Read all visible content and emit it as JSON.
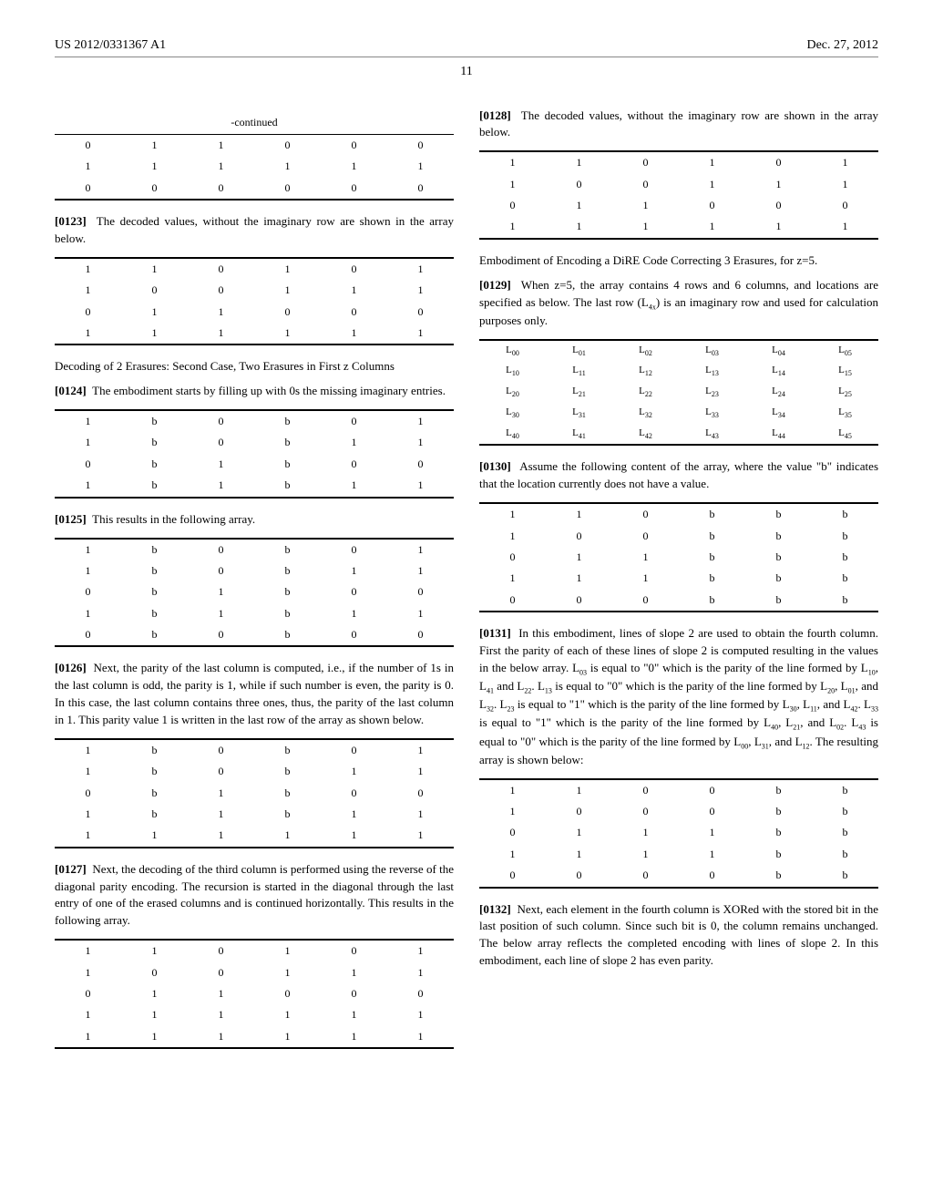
{
  "header": {
    "pub_number": "US 2012/0331367 A1",
    "pub_date": "Dec. 27, 2012"
  },
  "page_number": "11",
  "left": {
    "continued_title": "-continued",
    "t1": {
      "rows": [
        [
          "0",
          "1",
          "1",
          "0",
          "0",
          "0"
        ],
        [
          "1",
          "1",
          "1",
          "1",
          "1",
          "1"
        ],
        [
          "0",
          "0",
          "0",
          "0",
          "0",
          "0"
        ]
      ]
    },
    "p0123": {
      "num": "[0123]",
      "text": "The decoded values, without the imaginary row are shown in the array below."
    },
    "t2": {
      "rows": [
        [
          "1",
          "1",
          "0",
          "1",
          "0",
          "1"
        ],
        [
          "1",
          "0",
          "0",
          "1",
          "1",
          "1"
        ],
        [
          "0",
          "1",
          "1",
          "0",
          "0",
          "0"
        ],
        [
          "1",
          "1",
          "1",
          "1",
          "1",
          "1"
        ]
      ]
    },
    "subhead1": "Decoding of 2 Erasures: Second Case, Two Erasures in First z Columns",
    "p0124": {
      "num": "[0124]",
      "text": "The embodiment starts by filling up with 0s the missing imaginary entries."
    },
    "t3": {
      "rows": [
        [
          "1",
          "b",
          "0",
          "b",
          "0",
          "1"
        ],
        [
          "1",
          "b",
          "0",
          "b",
          "1",
          "1"
        ],
        [
          "0",
          "b",
          "1",
          "b",
          "0",
          "0"
        ],
        [
          "1",
          "b",
          "1",
          "b",
          "1",
          "1"
        ]
      ]
    },
    "p0125": {
      "num": "[0125]",
      "text": "This results in the following array."
    },
    "t4": {
      "rows": [
        [
          "1",
          "b",
          "0",
          "b",
          "0",
          "1"
        ],
        [
          "1",
          "b",
          "0",
          "b",
          "1",
          "1"
        ],
        [
          "0",
          "b",
          "1",
          "b",
          "0",
          "0"
        ],
        [
          "1",
          "b",
          "1",
          "b",
          "1",
          "1"
        ],
        [
          "0",
          "b",
          "0",
          "b",
          "0",
          "0"
        ]
      ]
    },
    "p0126": {
      "num": "[0126]",
      "text": "Next, the parity of the last column is computed, i.e., if the number of 1s in the last column is odd, the parity is 1, while if such number is even, the parity is 0. In this case, the last column contains three ones, thus, the parity of the last column in 1. This parity value 1 is written in the last row of the array as shown below."
    },
    "t5": {
      "rows": [
        [
          "1",
          "b",
          "0",
          "b",
          "0",
          "1"
        ],
        [
          "1",
          "b",
          "0",
          "b",
          "1",
          "1"
        ],
        [
          "0",
          "b",
          "1",
          "b",
          "0",
          "0"
        ],
        [
          "1",
          "b",
          "1",
          "b",
          "1",
          "1"
        ],
        [
          "1",
          "1",
          "1",
          "1",
          "1",
          "1"
        ]
      ]
    },
    "p0127": {
      "num": "[0127]",
      "text": "Next, the decoding of the third column is performed using the reverse of the diagonal parity encoding. The recursion is started in the diagonal through the last entry of one of the erased columns and is continued horizontally. This results in the following array."
    },
    "t6": {
      "rows": [
        [
          "1",
          "1",
          "0",
          "1",
          "0",
          "1"
        ],
        [
          "1",
          "0",
          "0",
          "1",
          "1",
          "1"
        ],
        [
          "0",
          "1",
          "1",
          "0",
          "0",
          "0"
        ],
        [
          "1",
          "1",
          "1",
          "1",
          "1",
          "1"
        ],
        [
          "1",
          "1",
          "1",
          "1",
          "1",
          "1"
        ]
      ]
    }
  },
  "right": {
    "p0128": {
      "num": "[0128]",
      "text": "The decoded values, without the imaginary row are shown in the array below."
    },
    "t7": {
      "rows": [
        [
          "1",
          "1",
          "0",
          "1",
          "0",
          "1"
        ],
        [
          "1",
          "0",
          "0",
          "1",
          "1",
          "1"
        ],
        [
          "0",
          "1",
          "1",
          "0",
          "0",
          "0"
        ],
        [
          "1",
          "1",
          "1",
          "1",
          "1",
          "1"
        ]
      ]
    },
    "subhead2": "Embodiment of Encoding a DiRE Code Correcting 3 Erasures, for z=5.",
    "p0129_a": "When z=5, the array contains 4 rows and 6 columns, and locations are specified as below. The last row (",
    "p0129_b": ") is an imaginary row and used for calculation purposes only.",
    "p0129_num": "[0129]",
    "t8": {
      "rows": [
        [
          "L00",
          "L01",
          "L02",
          "L03",
          "L04",
          "L05"
        ],
        [
          "L10",
          "L11",
          "L12",
          "L13",
          "L14",
          "L15"
        ],
        [
          "L20",
          "L21",
          "L22",
          "L23",
          "L24",
          "L25"
        ],
        [
          "L30",
          "L31",
          "L32",
          "L33",
          "L34",
          "L35"
        ],
        [
          "L40",
          "L41",
          "L42",
          "L43",
          "L44",
          "L45"
        ]
      ]
    },
    "p0130": {
      "num": "[0130]",
      "text": "Assume the following content of the array, where the value \"b\" indicates that the location currently does not have a value."
    },
    "t9": {
      "rows": [
        [
          "1",
          "1",
          "0",
          "b",
          "b",
          "b"
        ],
        [
          "1",
          "0",
          "0",
          "b",
          "b",
          "b"
        ],
        [
          "0",
          "1",
          "1",
          "b",
          "b",
          "b"
        ],
        [
          "1",
          "1",
          "1",
          "b",
          "b",
          "b"
        ],
        [
          "0",
          "0",
          "0",
          "b",
          "b",
          "b"
        ]
      ]
    },
    "p0131_num": "[0131]",
    "p0131_text_a": "In this embodiment, lines of slope 2 are used to obtain the fourth column. First the parity of each of these lines of slope 2 is computed resulting in the values in the below array. L",
    "p0131_text_b": " is equal to \"0\" which is the parity of the line formed by L",
    "p0131_text_c": ", L",
    "p0131_text_d": " and L",
    "p0131_text_e": ". L",
    "p0131_text_f": " is equal to \"0\" which is the parity of the line formed by L",
    "p0131_text_g": ", L",
    "p0131_text_h": ", and L",
    "p0131_text_i": ". L",
    "p0131_text_j": " is equal to \"1\" which is the parity of the line formed by L",
    "p0131_text_k": ", L",
    "p0131_text_l": ", and L",
    "p0131_text_m": ". L",
    "p0131_text_n": " is equal to \"1\" which is the parity of the line formed by L",
    "p0131_text_o": ", L",
    "p0131_text_p": ", and L",
    "p0131_text_q": ". L",
    "p0131_text_r": " is equal to \"0\" which is the parity of the line formed by L",
    "p0131_text_s": ", L",
    "p0131_text_t": ", and L",
    "p0131_text_u": ". The resulting array is shown below:",
    "t10": {
      "rows": [
        [
          "1",
          "1",
          "0",
          "0",
          "b",
          "b"
        ],
        [
          "1",
          "0",
          "0",
          "0",
          "b",
          "b"
        ],
        [
          "0",
          "1",
          "1",
          "1",
          "b",
          "b"
        ],
        [
          "1",
          "1",
          "1",
          "1",
          "b",
          "b"
        ],
        [
          "0",
          "0",
          "0",
          "0",
          "b",
          "b"
        ]
      ]
    },
    "p0132": {
      "num": "[0132]",
      "text": "Next, each element in the fourth column is XORed with the stored bit in the last position of such column. Since such bit is 0, the column remains unchanged. The below array reflects the completed encoding with lines of slope 2. In this embodiment, each line of slope 2 has even parity."
    }
  }
}
